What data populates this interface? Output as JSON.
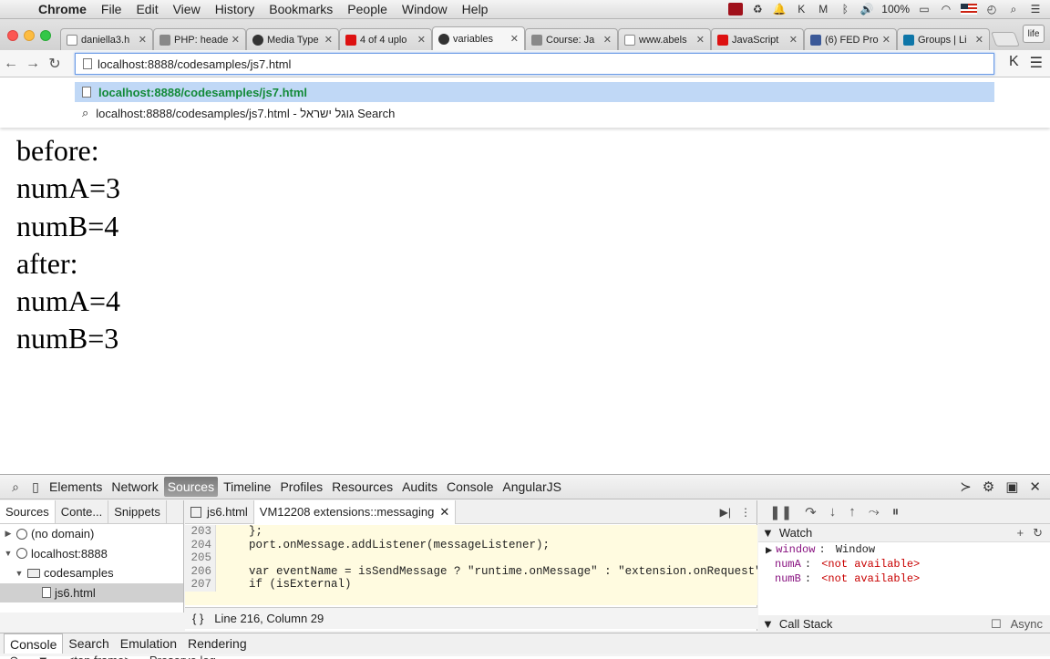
{
  "menubar": {
    "app": "Chrome",
    "items": [
      "File",
      "Edit",
      "View",
      "History",
      "Bookmarks",
      "People",
      "Window",
      "Help"
    ],
    "battery": "100%"
  },
  "tabs": [
    {
      "label": "daniella3.h",
      "icon": "doc"
    },
    {
      "label": "PHP: heade",
      "icon": "php"
    },
    {
      "label": "Media Type",
      "icon": "globe"
    },
    {
      "label": "4 of 4 uplo",
      "icon": "yt"
    },
    {
      "label": "variables",
      "icon": "gh",
      "active": true
    },
    {
      "label": "Course: Ja",
      "icon": "course"
    },
    {
      "label": "www.abels",
      "icon": "doc"
    },
    {
      "label": "JavaScript",
      "icon": "yt"
    },
    {
      "label": "(6) FED Pro",
      "icon": "fb"
    },
    {
      "label": "Groups | Li",
      "icon": "li"
    }
  ],
  "profile_label": "life",
  "omnibox": {
    "url": "localhost:8888/codesamples/js7.html"
  },
  "suggestions": [
    {
      "text": "localhost:8888/codesamples/js7.html"
    },
    {
      "text": "localhost:8888/codesamples/js7.html - גוגל ישראל Search"
    }
  ],
  "page": {
    "lines": [
      "before:",
      "numA=3",
      "numB=4",
      "after:",
      "numA=4",
      "numB=3"
    ]
  },
  "devtools": {
    "tabs": [
      "Elements",
      "Network",
      "Sources",
      "Timeline",
      "Profiles",
      "Resources",
      "Audits",
      "Console",
      "AngularJS"
    ],
    "active_tab": "Sources",
    "nav_tabs": [
      "Sources",
      "Conte...",
      "Snippets"
    ],
    "tree": [
      {
        "label": "(no domain)",
        "type": "globe",
        "depth": 0,
        "open": false
      },
      {
        "label": "localhost:8888",
        "type": "globe",
        "depth": 0,
        "open": true
      },
      {
        "label": "codesamples",
        "type": "folder",
        "depth": 1,
        "open": true
      },
      {
        "label": "js6.html",
        "type": "file",
        "depth": 2,
        "selected": true
      }
    ],
    "editor_tabs": [
      {
        "label": "js6.html",
        "active": false
      },
      {
        "label": "VM12208 extensions::messaging",
        "active": true
      }
    ],
    "code": [
      {
        "n": "203",
        "text": "    };"
      },
      {
        "n": "204",
        "text": "    port.onMessage.addListener(messageListener);"
      },
      {
        "n": "205",
        "text": ""
      },
      {
        "n": "206",
        "text": "    var eventName = isSendMessage ? \"runtime.onMessage\" : \"extension.onRequest\""
      },
      {
        "n": "207",
        "text": "    if (isExternal)"
      }
    ],
    "status": {
      "braces": "{ }",
      "position": "Line 216, Column 29"
    },
    "watch": {
      "title": "Watch",
      "rows": [
        {
          "key": "window",
          "value": "Window",
          "expandable": true
        },
        {
          "key": "numA",
          "value": "<not available>"
        },
        {
          "key": "numB",
          "value": "<not available>"
        }
      ]
    },
    "callstack": {
      "title": "Call Stack",
      "async_label": "Async"
    },
    "drawer_tabs": [
      "Console",
      "Search",
      "Emulation",
      "Rendering"
    ],
    "console_context": "<top frame>",
    "preserve_log": "Preserve log"
  }
}
